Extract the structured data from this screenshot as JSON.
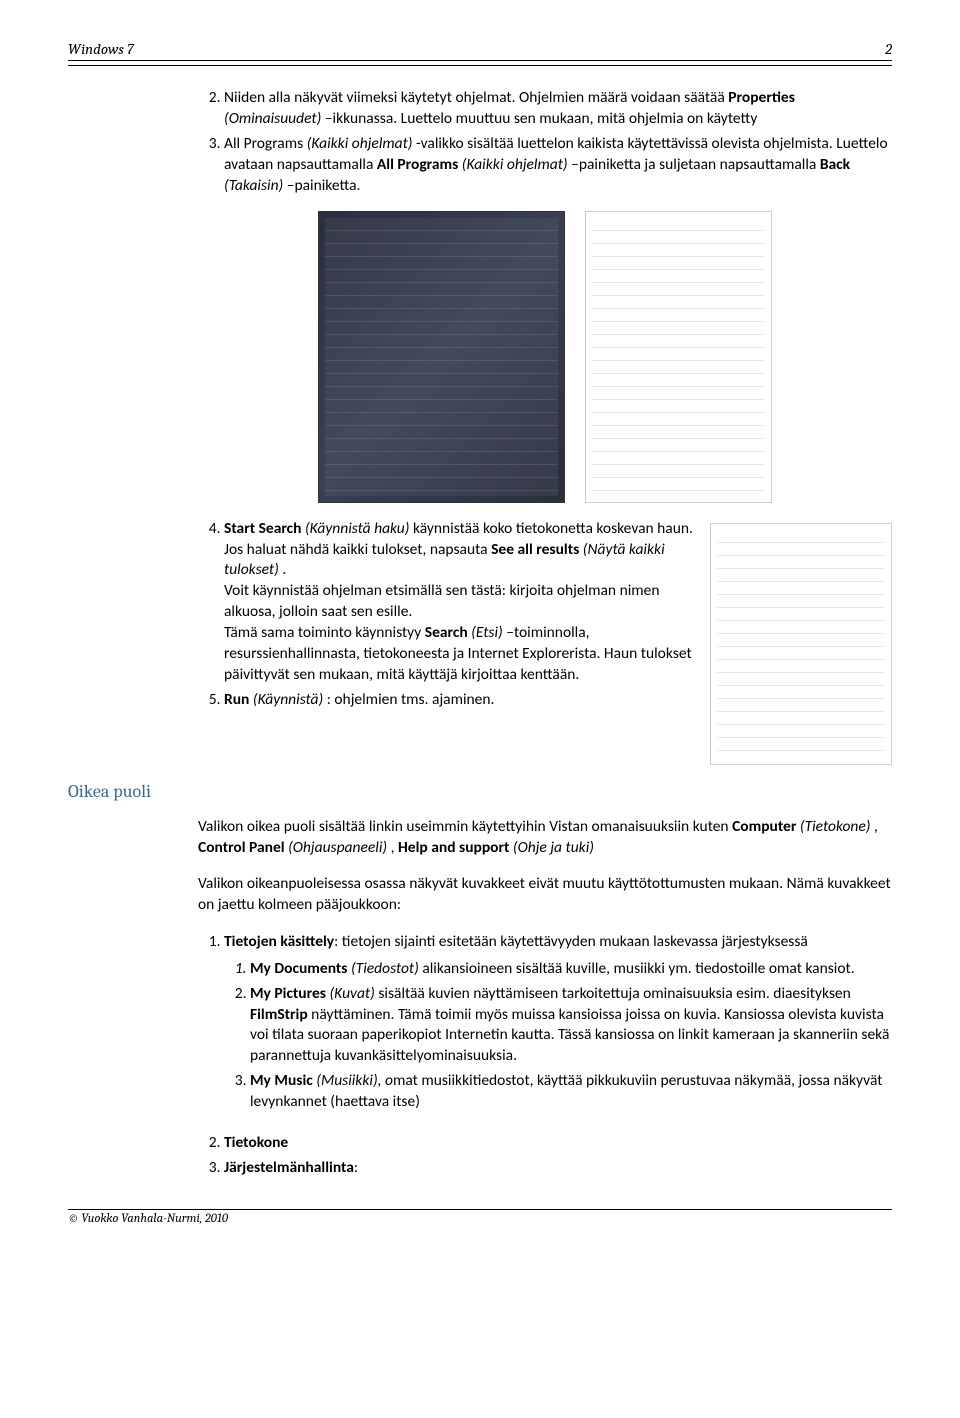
{
  "header": {
    "left": "Windows 7",
    "right": "2"
  },
  "list1": {
    "start": 2,
    "items": [
      {
        "prefix": "Niiden alla näkyvät viimeksi käytetyt ohjelmat. Ohjelmien määrä voidaan säätää ",
        "bold1": "Properties",
        "italic1": "(Ominaisuudet)",
        "rest": " –ikkunassa. Luettelo muuttuu sen mukaan, mitä ohjelmia on käytetty"
      },
      {
        "prefix": "All Programs ",
        "italic1": "(Kaikki ohjelmat)",
        "mid": " -valikko sisältää luettelon kaikista käytettävissä olevista ohjelmista. Luettelo avataan napsauttamalla ",
        "bold1": "All Programs",
        "italic2": " (Kaikki ohjelmat)",
        "rest": " –painiketta ja suljetaan napsauttamalla ",
        "bold2": "Back",
        "italic3": " (Takaisin)",
        "tail": " –painiketta."
      }
    ]
  },
  "list2": {
    "start": 4,
    "items": [
      {
        "b1": "Start Search",
        "i1": " (Käynnistä haku)",
        "t1": " käynnistää koko tietokonetta koskevan haun. Jos haluat nähdä kaikki tulokset, napsauta ",
        "b2": "See all results",
        "i2": " (Näytä kaikki tulokset)",
        "t2": ".",
        "l2": "Voit käynnistää ohjelman etsimällä sen tästä: kirjoita ohjelman nimen alkuosa, jolloin saat sen esille.",
        "l3a": "Tämä sama toiminto käynnistyy ",
        "b3": "Search",
        "i3": " (Etsi)",
        "l3b": " –toiminnolla, resurssienhallinnasta, tietokoneesta ja Internet Explorerista. Haun tulokset päivittyvät sen mukaan, mitä käyttäjä kirjoittaa kenttään."
      },
      {
        "b1": "Run",
        "i1": " (Käynnistä)",
        "t1": ": ohjelmien tms. ajaminen."
      }
    ]
  },
  "oikea": {
    "title": "Oikea puoli",
    "p1a": "Valikon oikea puoli sisältää linkin useimmin käytettyihin Vistan omanaisuuksiin kuten ",
    "p1b1": "Computer",
    "p1i1": "(Tietokone)",
    "p1c": " , ",
    "p1b2": "Control Panel",
    "p1i2": " (Ohjauspaneeli)",
    "p1d": ",  ",
    "p1b3": "Help and support",
    "p1i3": " (Ohje ja tuki)",
    "p2": "Valikon oikeanpuoleisessa osassa näkyvät kuvakkeet eivät muutu käyttötottumusten mukaan. Nämä kuvakkeet on jaettu kolmeen pääjoukkoon:"
  },
  "mainol": {
    "item1": {
      "b": "Tietojen käsittely",
      "t": ": tietojen sijainti esitetään käytettävyyden mukaan laskevassa järjestyksessä"
    },
    "sub": [
      {
        "b": "My Documents",
        "i": " (Tiedostot)",
        "t": " alikansioineen  sisältää kuville, musiikki ym. tiedostoille omat kansiot."
      },
      {
        "b": "My Pictures",
        "i": " (Kuvat)",
        "t": " sisältää kuvien näyttämiseen tarkoitettuja ominaisuuksia esim. diaesityksen ",
        "b2": "FilmStrip",
        "t2": "  näyttäminen. Tämä toimii myös muissa kansioissa joissa on kuvia. Kansiossa olevista kuvista voi tilata suoraan paperikopiot Internetin kautta. Tässä kansiossa on linkit kameraan ja skanneriin sekä parannettuja kuvankäsittelyominaisuuksia."
      },
      {
        "b": "My Music",
        "i": " (Musiikki), o",
        "t": "mat musiikkitiedostot, käyttää pikkukuviin perustuvaa näkymää, jossa näkyvät levynkannet (haettava itse)"
      }
    ],
    "item2": {
      "b": "Tietokone"
    },
    "item3": {
      "b": "Järjestelmänhallinta",
      "t": ":"
    }
  },
  "footer": "© Vuokko Vanhala-Nurmi, 2010"
}
